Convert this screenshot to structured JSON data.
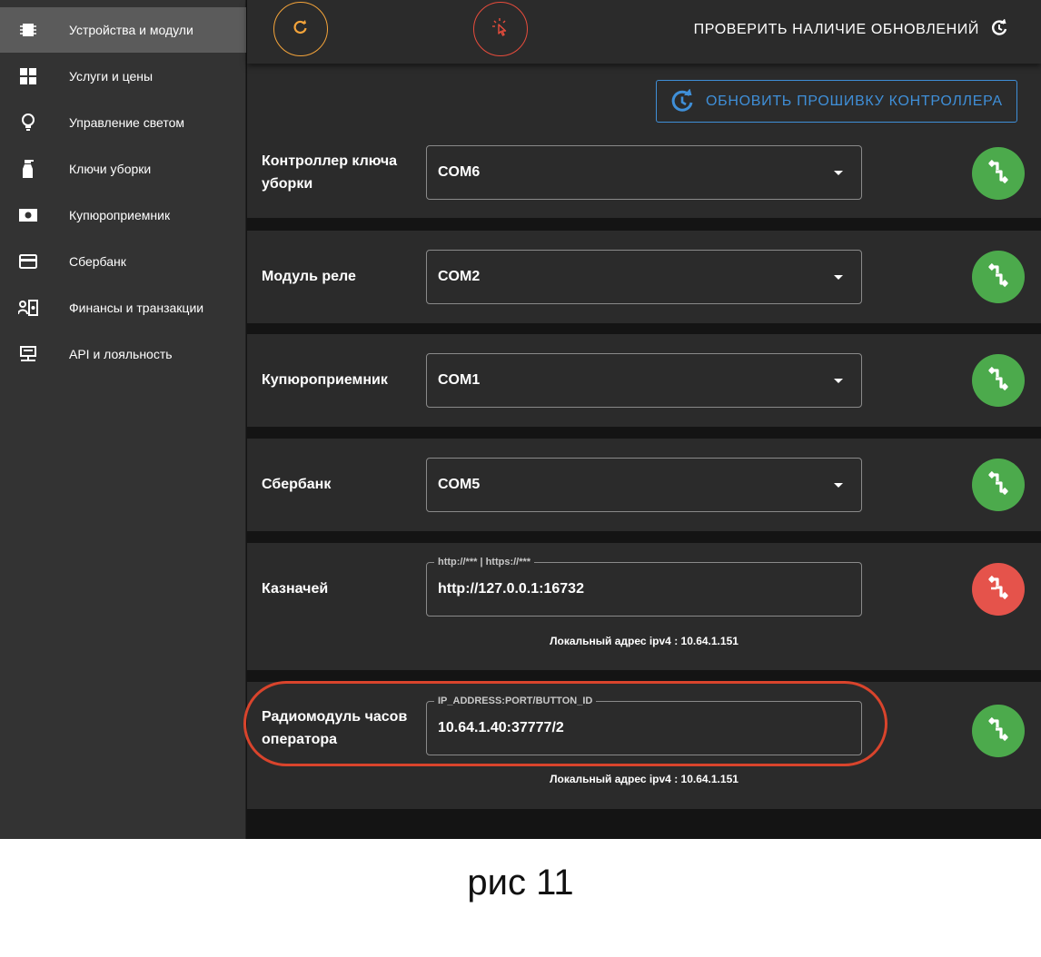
{
  "sidebar": {
    "items": [
      {
        "label": "Устройства и модули",
        "icon": "chip-icon",
        "active": true
      },
      {
        "label": "Услуги и цены",
        "icon": "grid-icon",
        "active": false
      },
      {
        "label": "Управление светом",
        "icon": "lightbulb-icon",
        "active": false
      },
      {
        "label": "Ключи уборки",
        "icon": "spray-bottle-icon",
        "active": false
      },
      {
        "label": "Купюроприемник",
        "icon": "banknote-icon",
        "active": false
      },
      {
        "label": "Сбербанк",
        "icon": "credit-card-icon",
        "active": false
      },
      {
        "label": "Финансы и транзакции",
        "icon": "finance-icon",
        "active": false
      },
      {
        "label": "API и лояльность",
        "icon": "api-icon",
        "active": false
      }
    ]
  },
  "topbar": {
    "check_updates_label": "ПРОВЕРИТЬ НАЛИЧИЕ ОБНОВЛЕНИЙ",
    "refresh_icon": "refresh-icon",
    "touch_icon": "touch-icon"
  },
  "main": {
    "firmware_button_label": "ОБНОВИТЬ ПРОШИВКУ КОНТРОЛЛЕРА",
    "rows": [
      {
        "label": "Контроллер ключа уборки",
        "value": "COM6",
        "type": "select",
        "status": "connected"
      },
      {
        "label": "Модуль реле",
        "value": "COM2",
        "type": "select",
        "status": "connected"
      },
      {
        "label": "Купюроприемник",
        "value": "COM1",
        "type": "select",
        "status": "connected"
      },
      {
        "label": "Сбербанк",
        "value": "COM5",
        "type": "select",
        "status": "connected"
      },
      {
        "label": "Казначей",
        "value": "http://127.0.0.1:16732",
        "type": "text",
        "legend": "http://*** | https://***",
        "status": "disconnected",
        "local_address": "Локальный адрес ipv4 : 10.64.1.151"
      },
      {
        "label": "Радиомодуль часов оператора",
        "value": "10.64.1.40:37777/2",
        "type": "text",
        "legend": "IP_ADDRESS:PORT/BUTTON_ID",
        "status": "connected",
        "local_address": "Локальный адрес ipv4 : 10.64.1.151"
      }
    ]
  },
  "caption": "рис 11",
  "colors": {
    "accent_orange": "#f3a33a",
    "accent_red": "#e74c3c",
    "accent_blue": "#3f8fd8",
    "status_green": "#4caa4c",
    "status_red": "#e5534b",
    "highlight": "#d9442c"
  }
}
